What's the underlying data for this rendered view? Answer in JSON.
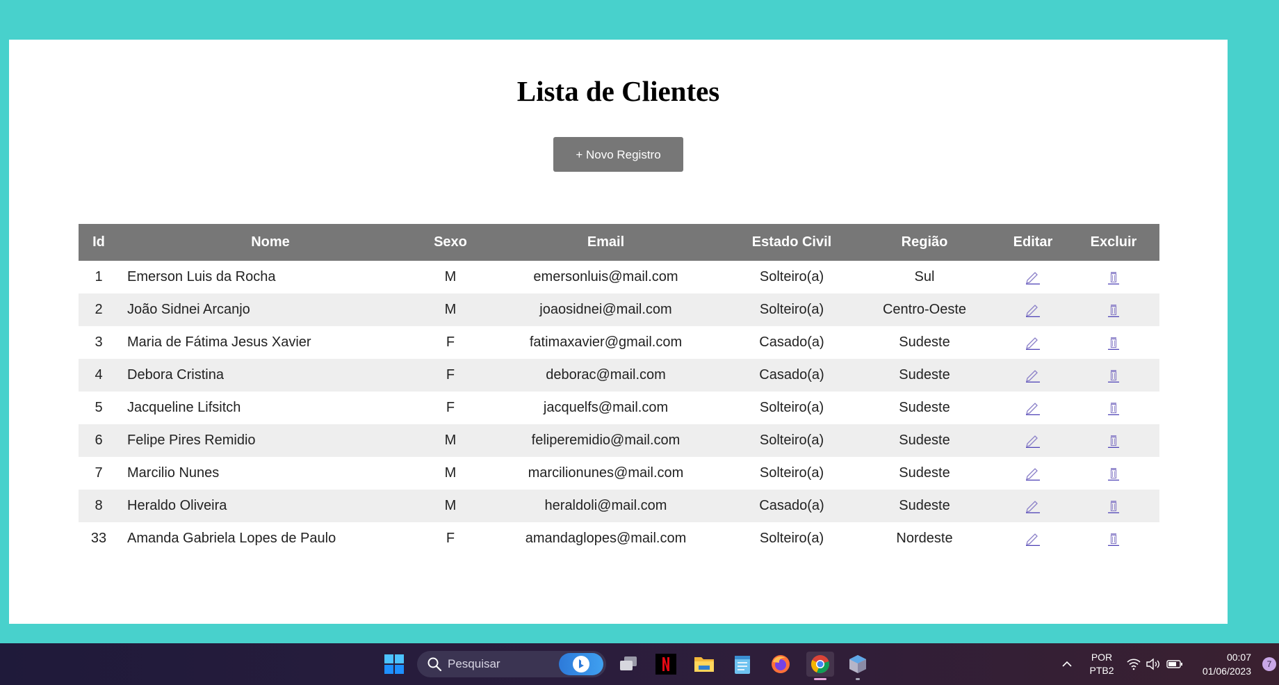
{
  "page": {
    "title": "Lista de Clientes",
    "new_button_label": "+ Novo Registro"
  },
  "table": {
    "headers": {
      "id": "Id",
      "nome": "Nome",
      "sexo": "Sexo",
      "email": "Email",
      "estado_civil": "Estado Civil",
      "regiao": "Região",
      "editar": "Editar",
      "excluir": "Excluir"
    },
    "rows": [
      {
        "id": "1",
        "nome": "Emerson Luis da Rocha",
        "sexo": "M",
        "email": "emersonluis@mail.com",
        "estado_civil": "Solteiro(a)",
        "regiao": "Sul"
      },
      {
        "id": "2",
        "nome": "João Sidnei Arcanjo",
        "sexo": "M",
        "email": "joaosidnei@mail.com",
        "estado_civil": "Solteiro(a)",
        "regiao": "Centro-Oeste"
      },
      {
        "id": "3",
        "nome": "Maria de Fátima Jesus Xavier",
        "sexo": "F",
        "email": "fatimaxavier@gmail.com",
        "estado_civil": "Casado(a)",
        "regiao": "Sudeste"
      },
      {
        "id": "4",
        "nome": "Debora Cristina",
        "sexo": "F",
        "email": "deborac@mail.com",
        "estado_civil": "Casado(a)",
        "regiao": "Sudeste"
      },
      {
        "id": "5",
        "nome": "Jacqueline Lifsitch",
        "sexo": "F",
        "email": "jacquelfs@mail.com",
        "estado_civil": "Solteiro(a)",
        "regiao": "Sudeste"
      },
      {
        "id": "6",
        "nome": "Felipe Pires Remidio",
        "sexo": "M",
        "email": "feliperemidio@mail.com",
        "estado_civil": "Solteiro(a)",
        "regiao": "Sudeste"
      },
      {
        "id": "7",
        "nome": "Marcilio Nunes",
        "sexo": "M",
        "email": "marcilionunes@mail.com",
        "estado_civil": "Solteiro(a)",
        "regiao": "Sudeste"
      },
      {
        "id": "8",
        "nome": "Heraldo Oliveira",
        "sexo": "M",
        "email": "heraldoli@mail.com",
        "estado_civil": "Casado(a)",
        "regiao": "Sudeste"
      },
      {
        "id": "33",
        "nome": "Amanda Gabriela Lopes de Paulo",
        "sexo": "F",
        "email": "amandaglopes@mail.com",
        "estado_civil": "Solteiro(a)",
        "regiao": "Nordeste"
      }
    ],
    "edit_icon": "pencil-icon",
    "delete_icon": "trash-icon"
  },
  "taskbar": {
    "search_placeholder": "Pesquisar",
    "apps": [
      "start-icon",
      "search-icon",
      "bing-icon",
      "task-view-icon",
      "netflix-icon",
      "file-explorer-icon",
      "notepad-icon",
      "firefox-icon",
      "chrome-icon",
      "virtualbox-icon"
    ],
    "language_line1": "POR",
    "language_line2": "PTB2",
    "time": "00:07",
    "date": "01/06/2023",
    "notification_count": "7"
  },
  "colors": {
    "background": "#48d1cc",
    "panel": "#ffffff",
    "header": "#777777",
    "button": "#777777",
    "row_alt": "#eeeeee",
    "link": "#4b3fb5"
  }
}
